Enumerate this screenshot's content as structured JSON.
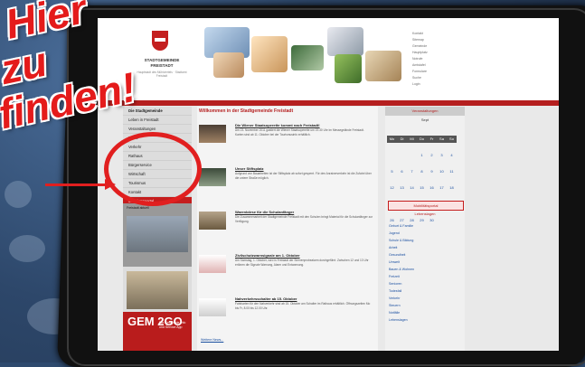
{
  "overlay": {
    "line1": "Hier",
    "line2": "zu",
    "line3": "finden!"
  },
  "header": {
    "logo_text": "STADTGEMEINDE FREISTADT",
    "logo_sub": "Hauptstadt des Mühlviertels · Stadtamt Freistadt",
    "top_links": [
      "Kontakt",
      "Sitemap",
      "Gemeinde",
      "Hauptplatz",
      "Notrufe",
      "Amtstafel",
      "Formulare",
      "Suche",
      "Login"
    ]
  },
  "leftnav": {
    "items": [
      {
        "label": "Die Stadtgemeinde",
        "active": false,
        "head": true
      },
      {
        "label": "Leben in Freistadt",
        "active": false,
        "head": false
      },
      {
        "label": "Veranstaltungen",
        "active": false,
        "head": false
      },
      {
        "label": "News",
        "active": false,
        "head": false
      },
      {
        "label": "Verkehr",
        "active": false,
        "head": false
      },
      {
        "label": "Rathaus",
        "active": false,
        "head": false
      },
      {
        "label": "Bürgerservice",
        "active": false,
        "head": false
      },
      {
        "label": "Wirtschaft",
        "active": false,
        "head": false
      },
      {
        "label": "Tourismus",
        "active": false,
        "head": false
      },
      {
        "label": "Kontakt",
        "active": false,
        "head": false
      },
      {
        "label": "Mobilitätsportal",
        "active": true,
        "head": false
      }
    ],
    "box_label": "Freistadt aktuell"
  },
  "gem_ad": {
    "big": "GEM 2GO",
    "small": "Die Gemeinde-Info und Service App"
  },
  "main": {
    "title": "Willkommen in der Stadtgemeinde Freistadt",
    "news": [
      {
        "h": "Die Wiener Staatsoperette kommt nach Freistadt!",
        "t": "Am 23. November 2011 gastiert die Wiener Staatsoperette um 19.30 Uhr im Messegelände Freistadt. Karten sind ab 11. Oktober bei der Tourismusinfo erhältlich."
      },
      {
        "h": "Unser Stiftsplatz",
        "t": "Aufgrund von Bauarbeiten ist der Stiftsplatz ab sofort gesperrt. Für den Anrainerverkehr ist die Zufahrt über die untere Straße möglich."
      },
      {
        "h": "Warenbörse für die Schulanfänger",
        "t": "Die Zusammenarbeit der Stadtgemeinde Freistadt mit den Schulen bringt Material für die Schulanfänger zur Verfügung."
      },
      {
        "h": "Zivilschutzwarnsignale am 1. Oktober",
        "t": "Am Samstag, 1. Oktober, wird in Freistadt der Sirenenprobealarm durchgeführt. Zwischen 12 und 13 Uhr ertönen die Signale Warnung, Alarm und Entwarnung."
      },
      {
        "h": "Nahverkehrsschalter ab 15. Oktober",
        "t": "Fahrkarten für den Nahverkehr sind ab 15. Oktober am Schalter im Rathaus erhältlich. Öffnungszeiten Mo bis Fr, 8.00 bis 12.00 Uhr."
      }
    ],
    "more": "Weitere News..."
  },
  "rcol": {
    "cal_header": "Veranstaltungen",
    "month_label": "Sept",
    "days": [
      "Mo",
      "Di",
      "Mi",
      "Do",
      "Fr",
      "Sa",
      "So"
    ],
    "cal_dates": [
      "",
      "",
      "",
      "1",
      "2",
      "3",
      "4",
      "5",
      "6",
      "7",
      "8",
      "9",
      "10",
      "11",
      "12",
      "13",
      "14",
      "15",
      "16",
      "17",
      "18",
      "19",
      "20",
      "21",
      "22",
      "23",
      "24",
      "25",
      "26",
      "27",
      "28",
      "29",
      "30",
      "",
      ""
    ],
    "button": "Mobilitätsportal",
    "sub_button": "Lebenslagen",
    "links": [
      "Geburt & Familie",
      "Jugend",
      "Schule & Bildung",
      "Arbeit",
      "Gesundheit",
      "Umwelt",
      "Bauen & Wohnen",
      "Freizeit",
      "Senioren",
      "Todesfall",
      "Verkehr",
      "Steuern",
      "Notfälle",
      "Lebenslagen"
    ]
  }
}
